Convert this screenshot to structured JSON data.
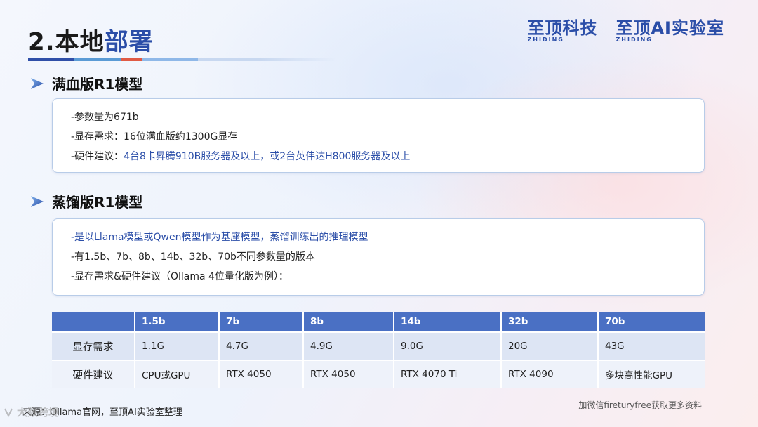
{
  "slide": {
    "title_prefix": "2.本地",
    "title_accent": "部署"
  },
  "logos": [
    {
      "main": "至顶科技",
      "sub": "ZHIDING"
    },
    {
      "main": "至顶AI实验室",
      "sub": "ZHIDING"
    }
  ],
  "section1": {
    "heading": "满血版R1模型",
    "lines": [
      "-参数量为671b",
      "-显存需求：16位满血版约1300G显存"
    ],
    "hw_prefix": "-硬件建议：",
    "hw_value": "4台8卡昇腾910B服务器及以上，或2台英伟达H800服务器及以上"
  },
  "section2": {
    "heading": "蒸馏版R1模型",
    "lines": [
      "-是以Llama模型或Qwen模型作为基座模型，蒸馏训练出的推理模型",
      "-有1.5b、7b、8b、14b、32b、70b不同参数量的版本",
      "-显存需求&硬件建议（Ollama 4位量化版为例）："
    ]
  },
  "table": {
    "headers": [
      "",
      "1.5b",
      "7b",
      "8b",
      "14b",
      "32b",
      "70b"
    ],
    "rows": [
      {
        "label": "显存需求",
        "cells": [
          "1.1G",
          "4.7G",
          "4.9G",
          "9.0G",
          "20G",
          "43G"
        ]
      },
      {
        "label": "硬件建议",
        "cells": [
          "CPU或GPU",
          "RTX 4050",
          "RTX 4050",
          "RTX 4070 Ti",
          "RTX 4090",
          "多块高性能GPU"
        ]
      }
    ]
  },
  "footer": {
    "source": "来源：Ollama官网，至顶AI实验室整理",
    "watermark": "大数跨境",
    "note": "加微信fireturyfree获取更多资料"
  },
  "colors": {
    "accent": "#2b4ea8",
    "table_header": "#4a70c4",
    "row1": "#dde5f4",
    "row2": "#eef2fa"
  }
}
